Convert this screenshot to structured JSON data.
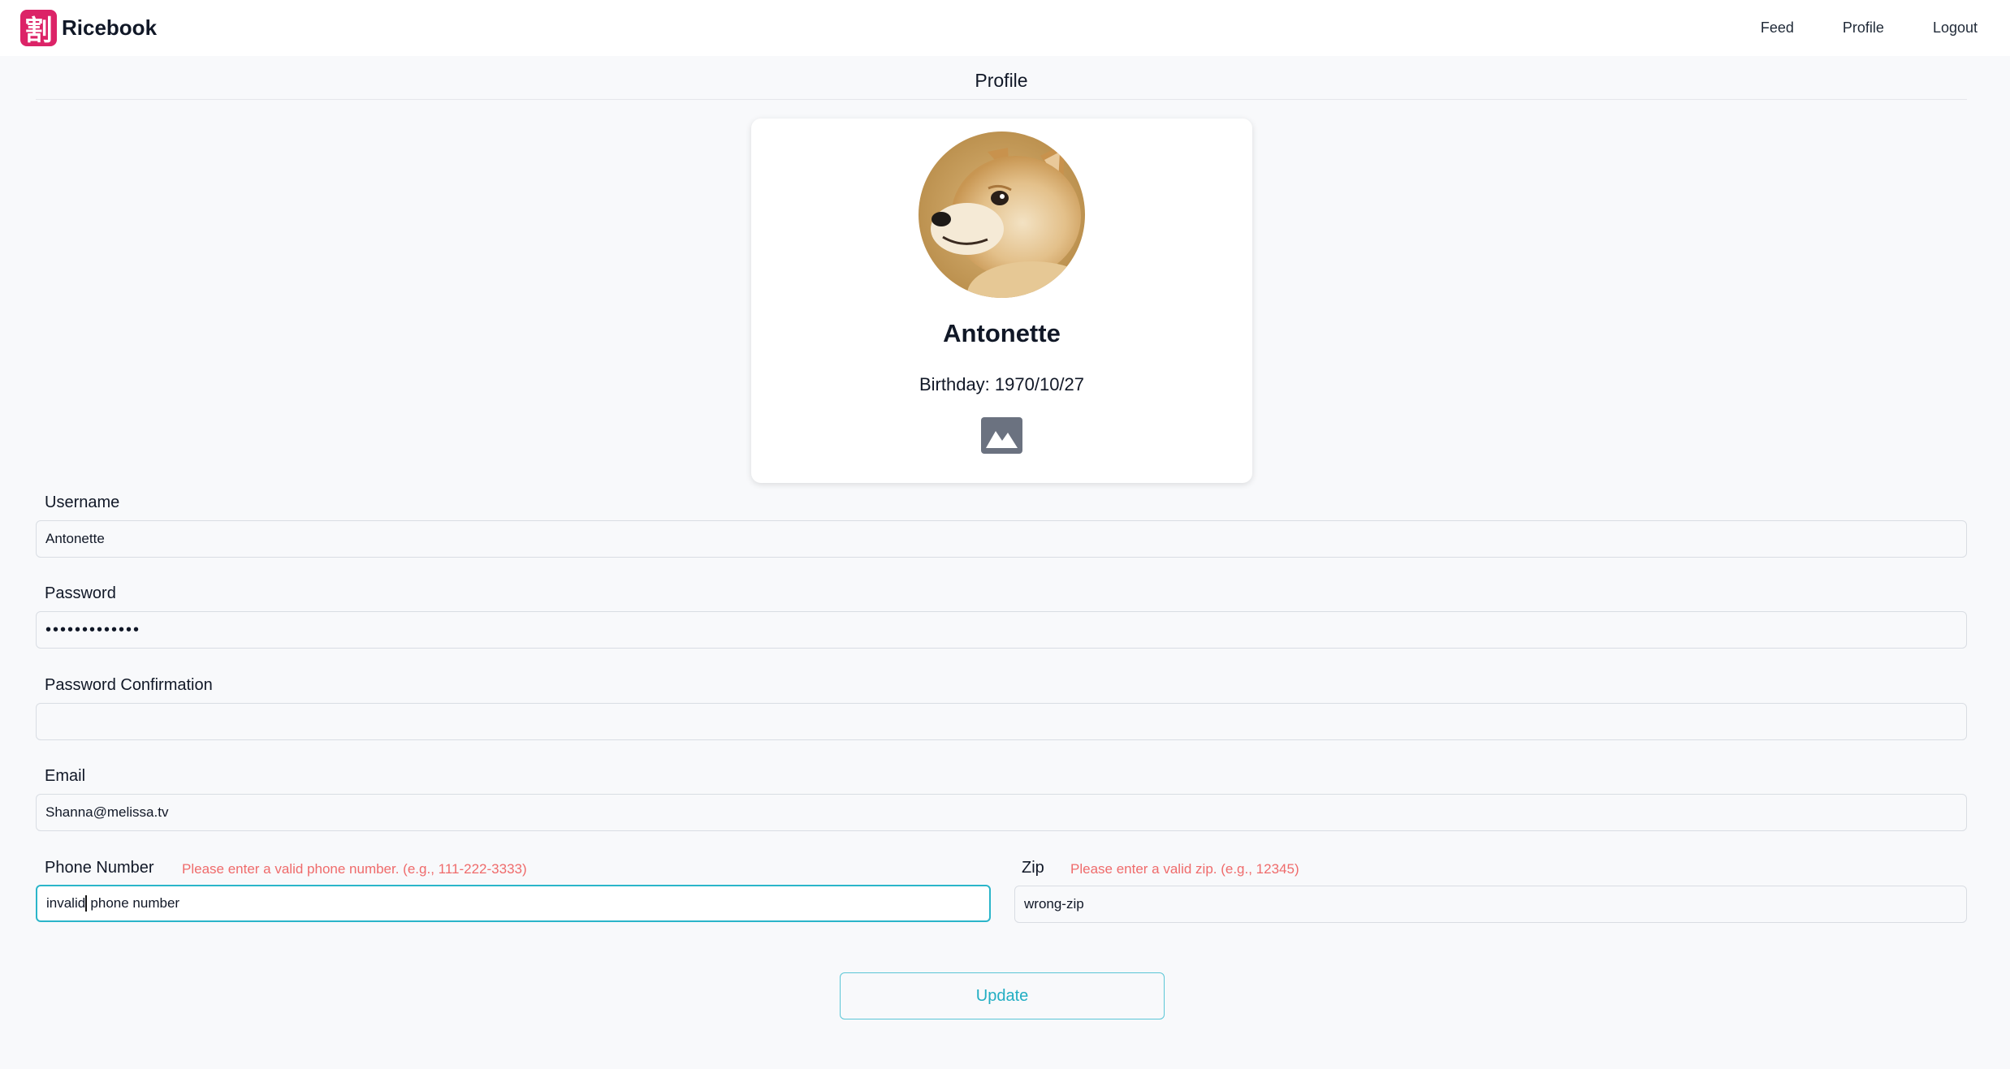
{
  "brand": {
    "logo_char": "割",
    "name": "Ricebook",
    "accent": "#dc2367"
  },
  "nav": {
    "items": [
      {
        "label": "Feed"
      },
      {
        "label": "Profile"
      },
      {
        "label": "Logout"
      }
    ]
  },
  "page": {
    "title": "Profile"
  },
  "profile": {
    "name": "Antonette",
    "birthday": "Birthday: 1970/10/27",
    "upload_icon": "image-icon"
  },
  "form": {
    "username": {
      "label": "Username",
      "value": "Antonette"
    },
    "password": {
      "label": "Password",
      "value": "•••••••••••••"
    },
    "password_confirmation": {
      "label": "Password Confirmation",
      "value": ""
    },
    "email": {
      "label": "Email",
      "value": "Shanna@melissa.tv"
    },
    "phone": {
      "label": "Phone Number",
      "error": "Please enter a valid phone number. (e.g., 111-222-3333)",
      "value_before_caret": "invalid",
      "value_after_caret": " phone number"
    },
    "zip": {
      "label": "Zip",
      "error": "Please enter a valid zip. (e.g., 12345)",
      "value": "wrong-zip"
    },
    "update_label": "Update"
  },
  "colors": {
    "error": "#ef6b6b",
    "focus": "#2bb5c9",
    "button_text": "#22aec3"
  }
}
